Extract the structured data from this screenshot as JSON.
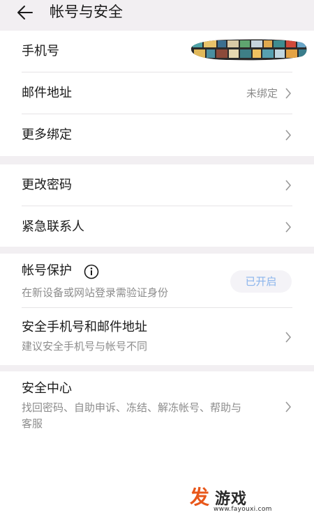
{
  "header": {
    "title": "帐号与安全"
  },
  "account": {
    "phone_label": "手机号",
    "email_label": "邮件地址",
    "email_value": "未绑定",
    "more_label": "更多绑定"
  },
  "password": {
    "change_label": "更改密码",
    "contact_label": "紧急联系人"
  },
  "protection": {
    "title": "帐号保护",
    "subtitle": "在新设备或网站登录需验证身份",
    "status": "已开启",
    "secure_label": "安全手机号和邮件地址",
    "secure_subtitle": "建议安全手机号与帐号不同"
  },
  "security_center": {
    "title": "安全中心",
    "desc_line1": "找回密码、自助申诉、冻结、解冻帐号、帮助与",
    "desc_line2": "客服"
  },
  "watermark": {
    "logo_char": "发",
    "brand": "游戏",
    "url": "www.fayouxi.com"
  },
  "colors": {
    "background": "#f2eff2",
    "card": "#ffffff",
    "status_text": "#8ab4ec",
    "watermark_accent": "#e8571a"
  }
}
